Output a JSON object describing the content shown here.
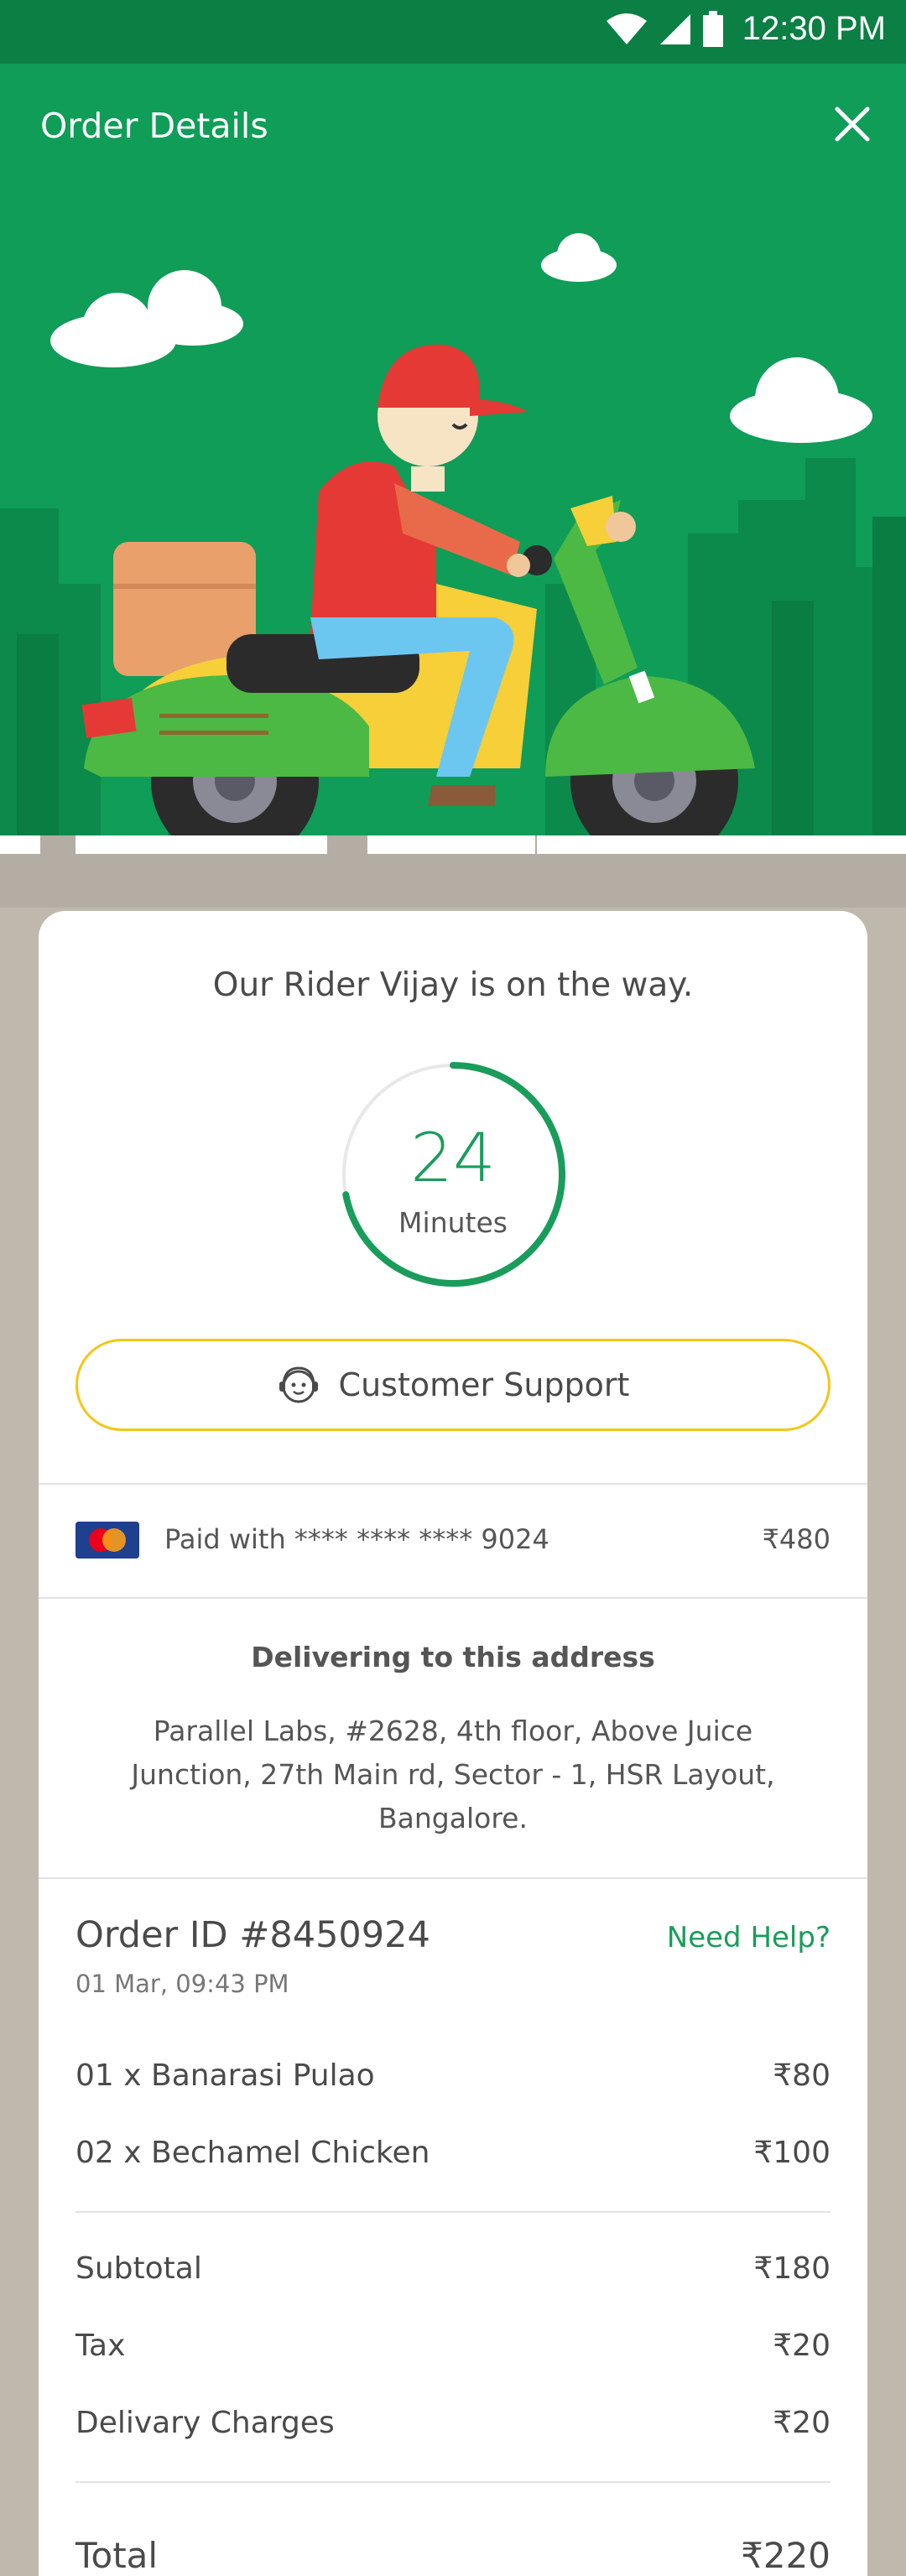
{
  "status_bar": {
    "time": "12:30 PM",
    "icons": [
      "wifi-icon",
      "signal-icon",
      "battery-icon"
    ]
  },
  "header": {
    "title": "Order Details",
    "close_icon": "close-icon"
  },
  "tracking": {
    "message": "Our Rider Vijay is on the way.",
    "eta_value": "24",
    "eta_unit": "Minutes",
    "eta_progress": 0.72,
    "support_label": "Customer Support",
    "support_icon": "support-agent-icon"
  },
  "payment": {
    "card_icon": "mastercard-icon",
    "label": "Paid with **** **** **** 9024",
    "amount": "₹480"
  },
  "address": {
    "title": "Delivering to this address",
    "text": "Parallel Labs, #2628, 4th floor, Above Juice Junction, 27th Main rd, Sector - 1, HSR Layout, Bangalore."
  },
  "order": {
    "id": "Order ID #8450924",
    "help_label": "Need Help?",
    "date": "01 Mar, 09:43 PM",
    "items": [
      {
        "name": "01 x  Banarasi Pulao",
        "price": "₹80"
      },
      {
        "name": "02 x  Bechamel Chicken",
        "price": "₹100"
      }
    ],
    "charges": [
      {
        "name": "Subtotal",
        "price": "₹180"
      },
      {
        "name": "Tax",
        "price": "₹20"
      },
      {
        "name": "Delivary Charges",
        "price": "₹20"
      }
    ],
    "total": {
      "name": "Total",
      "price": "₹220"
    }
  },
  "colors": {
    "primary_green": "#0f9d58",
    "status_bar_green": "#0b7f44",
    "accent_green": "#1a9c5b",
    "support_border": "#f5c518",
    "page_background": "#bfb9ad"
  }
}
